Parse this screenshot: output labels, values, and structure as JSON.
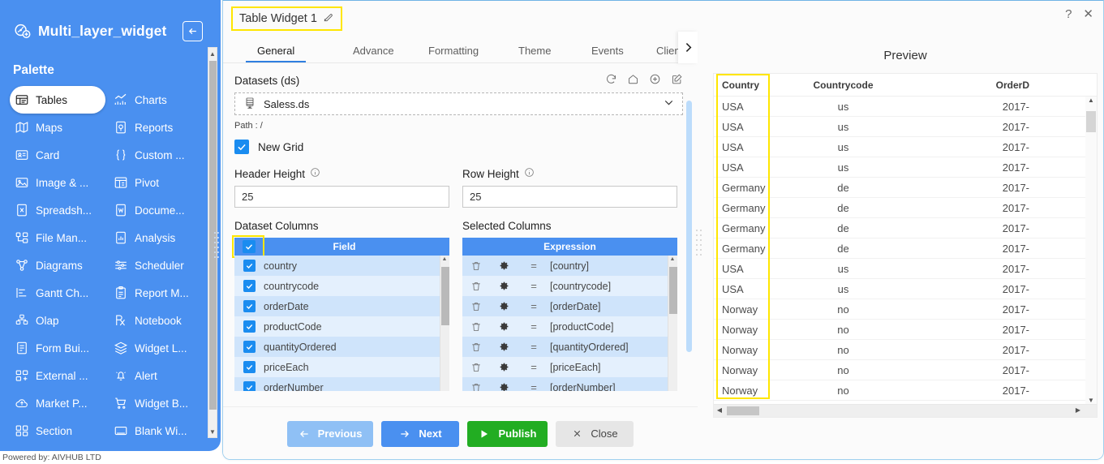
{
  "sidebar": {
    "title": "Multi_layer_widget",
    "logo_icon": "widget-layers-icon",
    "collapse_icon": "arrow-left-icon",
    "palette_label": "Palette",
    "powered_by": "Powered by: AIVHUB LTD",
    "items": [
      {
        "label": "Tables",
        "icon": "table-icon",
        "active": true
      },
      {
        "label": "Charts",
        "icon": "chart-icon",
        "active": false
      },
      {
        "label": "Maps",
        "icon": "map-icon",
        "active": false
      },
      {
        "label": "Reports",
        "icon": "report-icon",
        "active": false
      },
      {
        "label": "Card",
        "icon": "card-icon",
        "active": false
      },
      {
        "label": "Custom ...",
        "icon": "braces-icon",
        "active": false
      },
      {
        "label": "Image & ...",
        "icon": "image-icon",
        "active": false
      },
      {
        "label": "Pivot",
        "icon": "pivot-icon",
        "active": false
      },
      {
        "label": "Spreadsh...",
        "icon": "spreadsheet-icon",
        "active": false
      },
      {
        "label": "Docume...",
        "icon": "document-icon",
        "active": false
      },
      {
        "label": "File Man...",
        "icon": "file-manager-icon",
        "active": false
      },
      {
        "label": "Analysis",
        "icon": "analysis-icon",
        "active": false
      },
      {
        "label": "Diagrams",
        "icon": "diagram-icon",
        "active": false
      },
      {
        "label": "Scheduler",
        "icon": "scheduler-icon",
        "active": false
      },
      {
        "label": "Gantt Ch...",
        "icon": "gantt-icon",
        "active": false
      },
      {
        "label": "Report M...",
        "icon": "clipboard-icon",
        "active": false
      },
      {
        "label": "Olap",
        "icon": "olap-icon",
        "active": false
      },
      {
        "label": "Notebook",
        "icon": "notebook-icon",
        "active": false
      },
      {
        "label": "Form Bui...",
        "icon": "form-icon",
        "active": false
      },
      {
        "label": "Widget L...",
        "icon": "layers-icon",
        "active": false
      },
      {
        "label": "External ...",
        "icon": "external-add-icon",
        "active": false
      },
      {
        "label": "Alert",
        "icon": "bell-alert-icon",
        "active": false
      },
      {
        "label": "Market P...",
        "icon": "cloud-upload-icon",
        "active": false
      },
      {
        "label": "Widget B...",
        "icon": "cart-icon",
        "active": false
      },
      {
        "label": "Section",
        "icon": "section-icon",
        "active": false
      },
      {
        "label": "Blank Wi...",
        "icon": "blank-window-icon",
        "active": false
      }
    ]
  },
  "dialog": {
    "title": "Table Widget 1",
    "title_edit_icon": "pencil-edit-icon",
    "help_icon": "question-mark-icon",
    "close_icon": "close-x-icon",
    "tabs": [
      {
        "label": "General",
        "active": true
      },
      {
        "label": "Advance",
        "active": false
      },
      {
        "label": "Formatting",
        "active": false
      },
      {
        "label": "Theme",
        "active": false
      },
      {
        "label": "Events",
        "active": false
      },
      {
        "label": "Clien",
        "active": false
      }
    ],
    "tab_next_icon": "chevron-right-icon"
  },
  "form": {
    "datasets_label": "Datasets (ds)",
    "dataset_actions": [
      {
        "icon": "refresh-icon"
      },
      {
        "icon": "home-icon"
      },
      {
        "icon": "plus-circle-icon"
      },
      {
        "icon": "edit-square-icon"
      }
    ],
    "dataset_value": "Saless.ds",
    "dataset_icon": "database-icon",
    "dataset_chevron": "chevron-down-icon",
    "path_label": "Path : /",
    "new_grid_label": "New Grid",
    "new_grid_checked": true,
    "header_height_label": "Header Height",
    "header_height_value": "25",
    "row_height_label": "Row Height",
    "row_height_value": "25",
    "info_icon": "info-circle-icon",
    "dataset_columns_label": "Dataset Columns",
    "selected_columns_label": "Selected Columns",
    "field_column_header": "Field",
    "expression_column_header": "Expression",
    "fields": [
      {
        "name": "country",
        "checked": true,
        "expression": "[country]"
      },
      {
        "name": "countrycode",
        "checked": true,
        "expression": "[countrycode]"
      },
      {
        "name": "orderDate",
        "checked": true,
        "expression": "[orderDate]"
      },
      {
        "name": "productCode",
        "checked": true,
        "expression": "[productCode]"
      },
      {
        "name": "quantityOrdered",
        "checked": true,
        "expression": "[quantityOrdered]"
      },
      {
        "name": "priceEach",
        "checked": true,
        "expression": "[priceEach]"
      },
      {
        "name": "orderNumber",
        "checked": true,
        "expression": "[orderNumber]"
      }
    ],
    "row_icons": {
      "delete": "trash-icon",
      "settings": "gear-icon",
      "equals": "equals-sign"
    }
  },
  "buttons": {
    "previous": {
      "label": "Previous",
      "icon": "arrow-left-icon"
    },
    "next": {
      "label": "Next",
      "icon": "arrow-right-icon"
    },
    "publish": {
      "label": "Publish",
      "icon": "play-triangle-icon"
    },
    "close": {
      "label": "Close",
      "icon": "close-x-icon"
    }
  },
  "preview": {
    "title": "Preview",
    "columns": [
      "Country",
      "Countrycode",
      "OrderD"
    ],
    "rows": [
      [
        "USA",
        "us",
        "2017-"
      ],
      [
        "USA",
        "us",
        "2017-"
      ],
      [
        "USA",
        "us",
        "2017-"
      ],
      [
        "USA",
        "us",
        "2017-"
      ],
      [
        "Germany",
        "de",
        "2017-"
      ],
      [
        "Germany",
        "de",
        "2017-"
      ],
      [
        "Germany",
        "de",
        "2017-"
      ],
      [
        "Germany",
        "de",
        "2017-"
      ],
      [
        "USA",
        "us",
        "2017-"
      ],
      [
        "USA",
        "us",
        "2017-"
      ],
      [
        "Norway",
        "no",
        "2017-"
      ],
      [
        "Norway",
        "no",
        "2017-"
      ],
      [
        "Norway",
        "no",
        "2017-"
      ],
      [
        "Norway",
        "no",
        "2017-"
      ],
      [
        "Norway",
        "no",
        "2017-"
      ]
    ]
  },
  "colors": {
    "brand_blue": "#4a90f0",
    "accent_blue": "#1a8cf0",
    "publish_green": "#22ad22",
    "highlight_yellow": "#ffe600",
    "row_odd": "#cfe4fb",
    "row_even": "#e4f0fd"
  }
}
